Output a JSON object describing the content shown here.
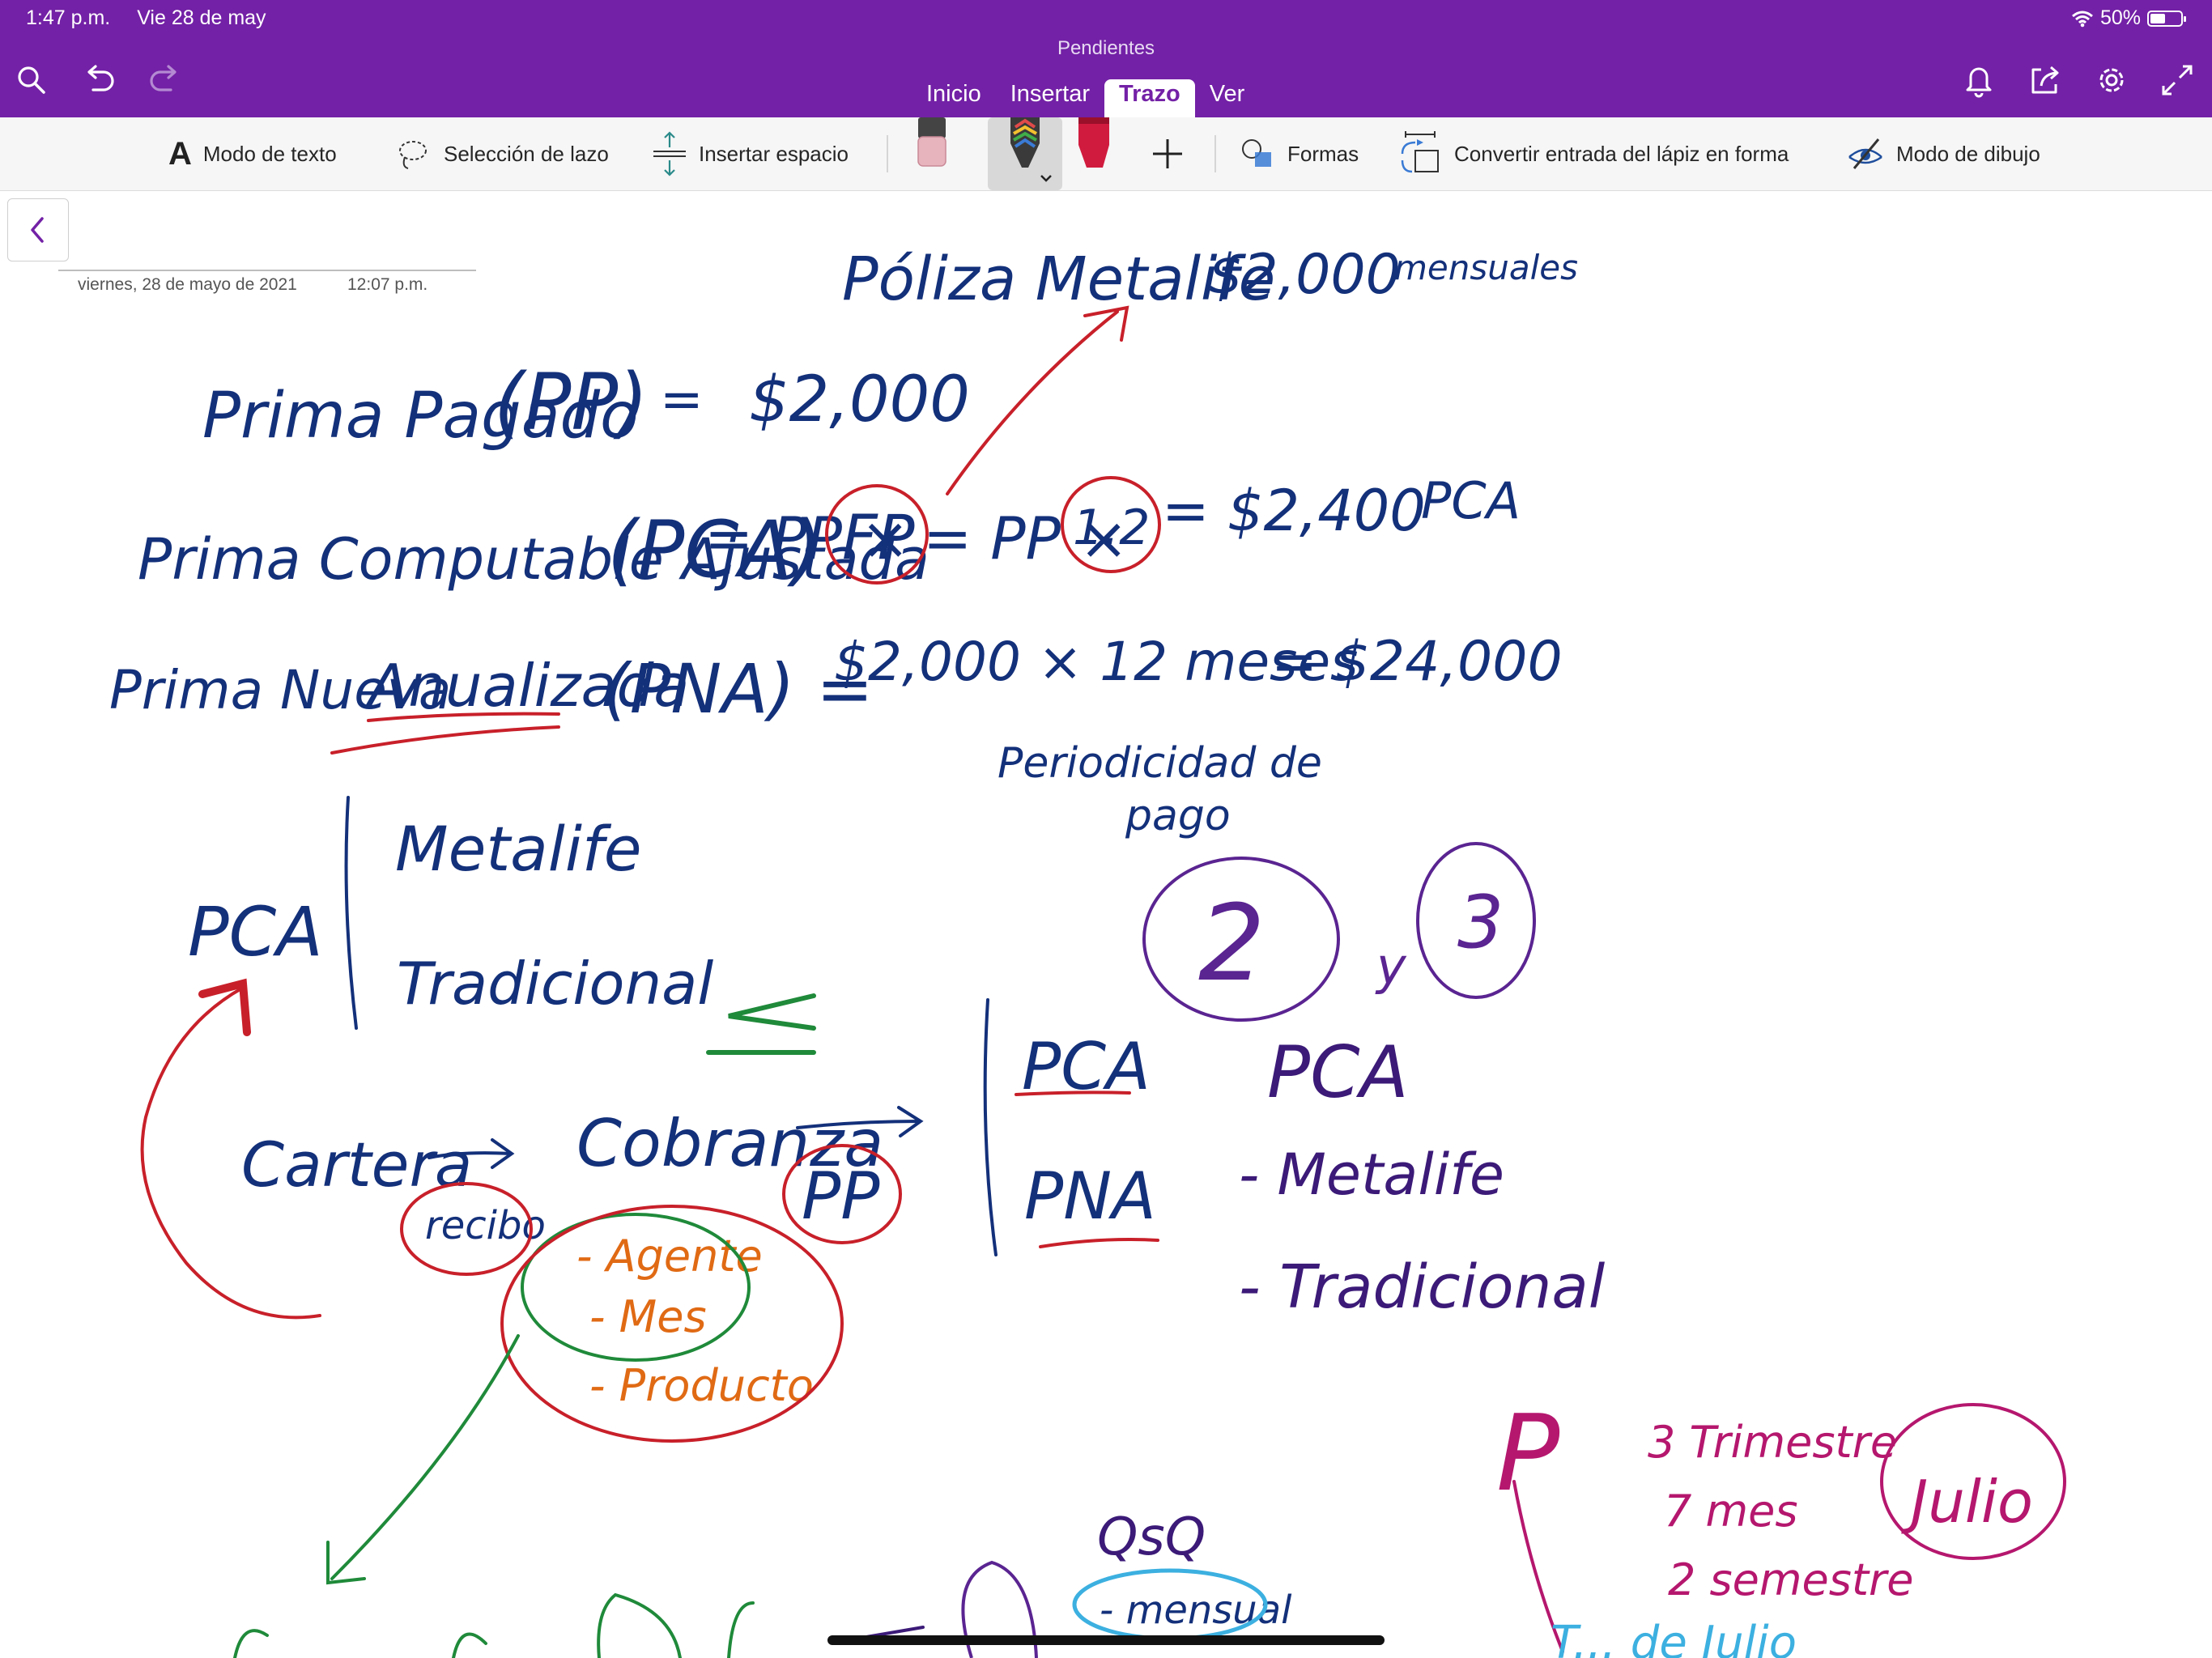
{
  "status_bar": {
    "time": "1:47 p.m.",
    "date": "Vie 28 de may",
    "battery": "50%",
    "battery_level": 0.5
  },
  "header": {
    "notebook_title": "Pendientes",
    "tabs": [
      {
        "label": "Inicio"
      },
      {
        "label": "Insertar"
      },
      {
        "label": "Trazo",
        "active": true
      },
      {
        "label": "Ver"
      }
    ]
  },
  "toolbar": {
    "text_mode": "Modo de texto",
    "lasso": "Selección de lazo",
    "insert_space": "Insertar espacio",
    "shapes": "Formas",
    "ink_to_shape": "Convertir entrada del lápiz en forma",
    "draw_mode": "Modo de dibujo"
  },
  "page": {
    "date": "viernes, 28 de mayo de 2021",
    "time": "12:07 p.m.",
    "ink": {
      "l1": "Póliza Metalife",
      "l1b": "$2,000",
      "l1c": "mensuales",
      "l2a": "Prima Pagado",
      "l2b": "(PP)",
      "l2c": "=",
      "l2d": "$2,000",
      "l3a": "Prima Computable Ajustada",
      "l3b": "(PCA)",
      "l3c": "= PP ×",
      "l3d": "FP",
      "l3e": "= PP ×",
      "l3f": "1.2",
      "l3g": "= $2,400",
      "l3h": "PCA",
      "l4a": "Prima Nueva",
      "l4b": "Anualizada",
      "l4c": "(PNA) =",
      "l4d": "$2,000 × 12 meses",
      "l4e": "= $24,000",
      "l5a": "Periodicidad de",
      "l5b": "pago",
      "pca": "PCA",
      "metalife": "Metalife",
      "tradicional": "Tradicional",
      "cartera": "Cartera",
      "recibo": "recibo",
      "cobranza": "Cobranza",
      "pp": "PP",
      "agente": "- Agente",
      "mes": "- Mes",
      "producto": "- Producto",
      "r_pca": "PCA",
      "r_pna": "PNA",
      "n2": "2",
      "y": "y",
      "n3": "3",
      "pca2": "PCA",
      "metalife2": "- Metalife",
      "tradicional2": "- Tradicional",
      "p": "P",
      "trim1": "3 Trimestre",
      "trim2": "7 mes",
      "trim3": "2 semestre",
      "julio": "Julio",
      "qsq": "QsQ",
      "mensual": "- mensual",
      "bottom_blue": "T... de Julio"
    }
  }
}
